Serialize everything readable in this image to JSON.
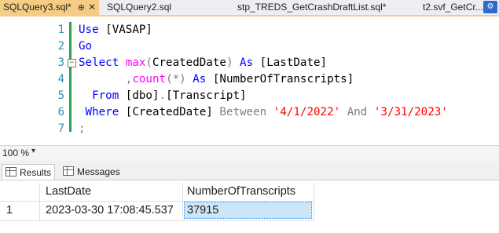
{
  "tabs": [
    {
      "label": "SQLQuery3.sql*",
      "active": true
    },
    {
      "label": "SQLQuery2.sql",
      "active": false
    },
    {
      "label": "stp_TREDS_GetCrashDraftList.sql*",
      "active": false
    },
    {
      "label": "t2.svf_GetCr...",
      "active": false
    }
  ],
  "tab_pin_glyph": "⊕",
  "tab_close_glyph": "✕",
  "editor": {
    "lines": [
      {
        "n": "1",
        "tokens": [
          {
            "t": "Use",
            "c": "kw"
          },
          {
            "t": " [VASAP]",
            "c": ""
          }
        ]
      },
      {
        "n": "2",
        "tokens": [
          {
            "t": "Go",
            "c": "kw"
          }
        ]
      },
      {
        "n": "3",
        "tokens": [
          {
            "t": "Select",
            "c": "kw"
          },
          {
            "t": " ",
            "c": ""
          },
          {
            "t": "max",
            "c": "fn"
          },
          {
            "t": "(",
            "c": "op"
          },
          {
            "t": "CreatedDate",
            "c": ""
          },
          {
            "t": ")",
            "c": "op"
          },
          {
            "t": " ",
            "c": ""
          },
          {
            "t": "As",
            "c": "kw"
          },
          {
            "t": " [LastDate]",
            "c": ""
          }
        ]
      },
      {
        "n": "4",
        "tokens": [
          {
            "t": "       ",
            "c": ""
          },
          {
            "t": ",",
            "c": "op"
          },
          {
            "t": "count",
            "c": "fn"
          },
          {
            "t": "(*)",
            "c": "op"
          },
          {
            "t": " ",
            "c": ""
          },
          {
            "t": "As",
            "c": "kw"
          },
          {
            "t": " [NumberOfTranscripts]",
            "c": ""
          }
        ]
      },
      {
        "n": "5",
        "tokens": [
          {
            "t": "  ",
            "c": ""
          },
          {
            "t": "From",
            "c": "kw"
          },
          {
            "t": " [dbo]",
            "c": ""
          },
          {
            "t": ".",
            "c": "op"
          },
          {
            "t": "[Transcript]",
            "c": ""
          }
        ]
      },
      {
        "n": "6",
        "tokens": [
          {
            "t": " ",
            "c": ""
          },
          {
            "t": "Where",
            "c": "kw"
          },
          {
            "t": " [CreatedDate] ",
            "c": ""
          },
          {
            "t": "Between",
            "c": "op"
          },
          {
            "t": " ",
            "c": ""
          },
          {
            "t": "'4/1/2022'",
            "c": "str"
          },
          {
            "t": " ",
            "c": ""
          },
          {
            "t": "And",
            "c": "op"
          },
          {
            "t": " ",
            "c": ""
          },
          {
            "t": "'3/31/2023'",
            "c": "str"
          }
        ]
      },
      {
        "n": "7",
        "tokens": [
          {
            "t": ";",
            "c": "op"
          }
        ]
      }
    ],
    "collapse_glyph": "−"
  },
  "zoom": {
    "value": "100 %",
    "dropdown_glyph": "▾"
  },
  "results_tabs": [
    {
      "label": "Results",
      "active": true
    },
    {
      "label": "Messages",
      "active": false
    }
  ],
  "grid": {
    "columns": [
      "LastDate",
      "NumberOfTranscripts"
    ],
    "rows": [
      {
        "rownum": "1",
        "cells": [
          "2023-03-30 17:08:45.537",
          "37915"
        ]
      }
    ]
  }
}
